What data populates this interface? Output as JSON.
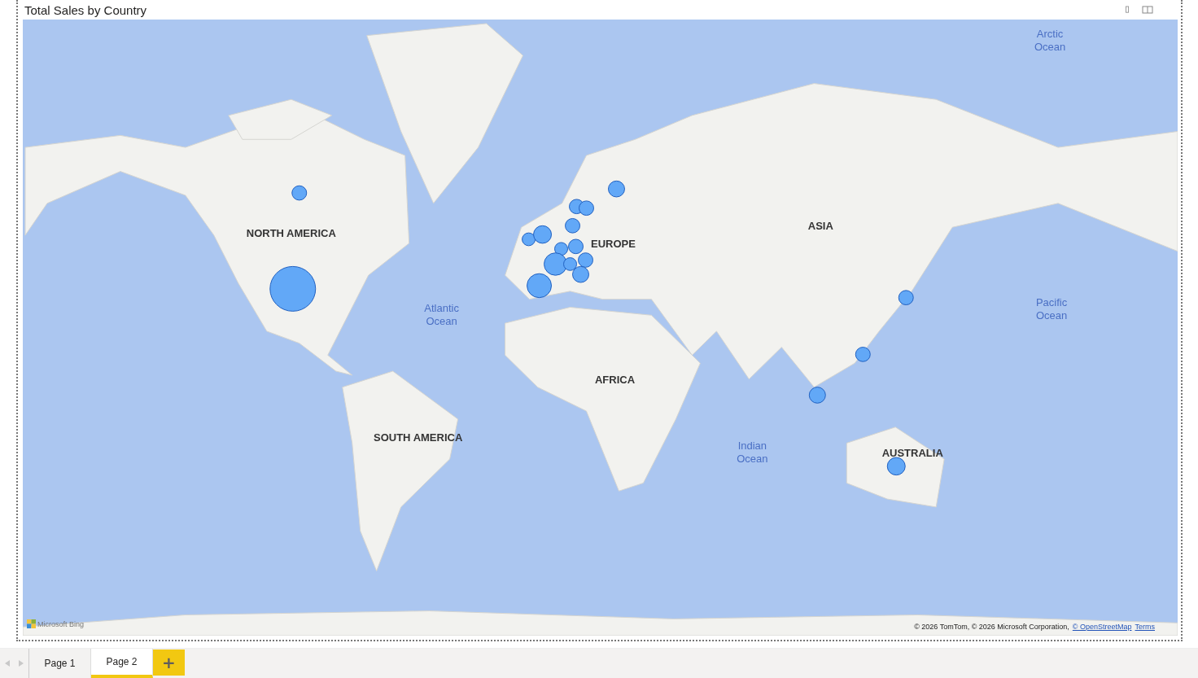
{
  "visual": {
    "title": "Total Sales by Country"
  },
  "map_labels": [
    {
      "text": "Arctic Ocean",
      "kind": "ocean"
    },
    {
      "text": "NORTH AMERICA",
      "kind": "continent"
    },
    {
      "text": "ASIA",
      "kind": "continent"
    },
    {
      "text": "EUROPE",
      "kind": "continent"
    },
    {
      "text": "Pacific Ocean",
      "kind": "ocean"
    },
    {
      "text": "Atlantic Ocean",
      "kind": "ocean"
    },
    {
      "text": "AFRICA",
      "kind": "continent"
    },
    {
      "text": "SOUTH AMERICA",
      "kind": "continent"
    },
    {
      "text": "Indian Ocean",
      "kind": "ocean"
    },
    {
      "text": "AUSTRALIA",
      "kind": "continent"
    }
  ],
  "attribution": {
    "brand": "Microsoft Bing",
    "copyright": "© 2026 TomTom, © 2026 Microsoft Corporation,",
    "links": [
      "© OpenStreetMap",
      "Terms"
    ]
  },
  "page_tabs": [
    {
      "label": "Page 1",
      "selected": false
    },
    {
      "label": "Page 2",
      "selected": true
    }
  ],
  "add_page": "+"
}
